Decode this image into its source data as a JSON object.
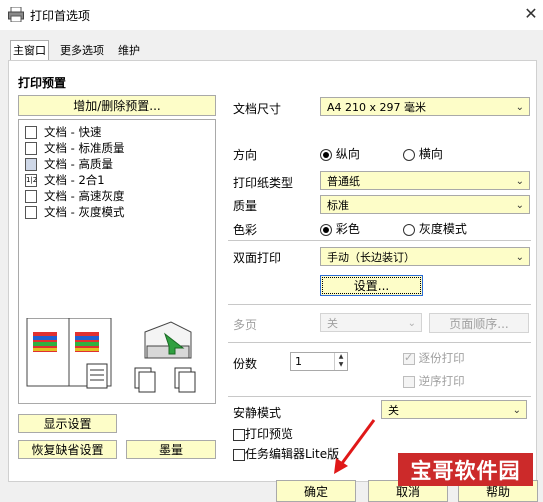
{
  "window": {
    "title": "打印首选项",
    "close_symbol": "✕"
  },
  "tabs": [
    {
      "label": "主窗口"
    },
    {
      "label": "更多选项"
    },
    {
      "label": "维护"
    }
  ],
  "presets": {
    "heading": "打印预置",
    "add_remove_button": "增加/删除预置...",
    "items": [
      {
        "label": "文档 - 快速",
        "icon": "document-icon"
      },
      {
        "label": "文档 - 标准质量",
        "icon": "document-icon"
      },
      {
        "label": "文档 - 高质量",
        "icon": "photo-document-icon"
      },
      {
        "label": "文档 - 2合1",
        "icon": "two-up-icon"
      },
      {
        "label": "文档 - 高速灰度",
        "icon": "document-icon"
      },
      {
        "label": "文档 - 灰度模式",
        "icon": "document-icon"
      }
    ]
  },
  "settings": {
    "paper_size": {
      "label": "文档尺寸",
      "value": "A4 210 x 297 毫米"
    },
    "orientation": {
      "label": "方向",
      "options": [
        "纵向",
        "横向"
      ],
      "selected": "纵向"
    },
    "paper_type": {
      "label": "打印纸类型",
      "value": "普通纸"
    },
    "quality": {
      "label": "质量",
      "value": "标准"
    },
    "color": {
      "label": "色彩",
      "options": [
        "彩色",
        "灰度模式"
      ],
      "selected": "彩色"
    },
    "duplex": {
      "label": "双面打印",
      "value": "手动（长边装订）",
      "settings_button": "设置..."
    },
    "multipage": {
      "label": "多页",
      "value": "关",
      "order_button": "页面顺序..."
    },
    "copies": {
      "label": "份数",
      "value": "1",
      "collate_label": "逐份打印",
      "reverse_label": "逆序打印",
      "collate_checked": true,
      "reverse_checked": false
    },
    "quiet_mode": {
      "label": "安静模式",
      "value": "关"
    },
    "print_preview": {
      "label": "打印预览",
      "checked": false
    },
    "job_arranger": {
      "label": "任务编辑器Lite版",
      "checked": false
    }
  },
  "buttons": {
    "show_settings": "显示设置",
    "restore_defaults": "恢复缺省设置",
    "ink_levels": "墨量",
    "ok": "确定",
    "cancel": "取消",
    "help": "帮助"
  },
  "watermark": {
    "text": "宝哥软件园"
  },
  "colors": {
    "button_bg": "#fdfdc8",
    "accent_red": "#cc2a2a",
    "arrow_red": "#e01818"
  }
}
